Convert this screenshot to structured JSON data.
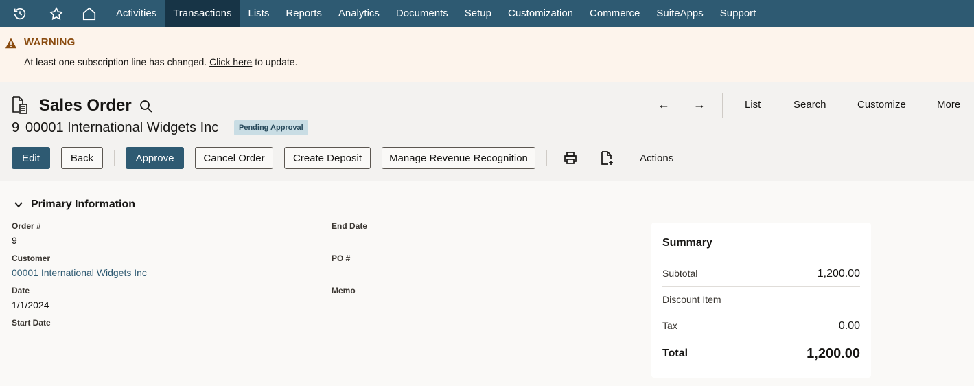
{
  "nav": {
    "icons": [
      "history-icon",
      "star-icon",
      "home-icon"
    ],
    "items": [
      {
        "label": "Activities"
      },
      {
        "label": "Transactions"
      },
      {
        "label": "Lists"
      },
      {
        "label": "Reports"
      },
      {
        "label": "Analytics"
      },
      {
        "label": "Documents"
      },
      {
        "label": "Setup"
      },
      {
        "label": "Customization"
      },
      {
        "label": "Commerce"
      },
      {
        "label": "SuiteApps"
      },
      {
        "label": "Support"
      }
    ],
    "active": "Transactions"
  },
  "warning": {
    "title": "WARNING",
    "message_before": "At least one subscription line has changed.",
    "link_text": "Click here",
    "message_after": "to update."
  },
  "header": {
    "title": "Sales Order",
    "record_number": "9",
    "record_name": "00001 International Widgets Inc",
    "status": "Pending Approval",
    "nav_links": {
      "list": "List",
      "search": "Search",
      "customize": "Customize",
      "more": "More"
    },
    "prev_arrow": "←",
    "next_arrow": "→"
  },
  "buttons": {
    "edit": "Edit",
    "back": "Back",
    "approve": "Approve",
    "cancel_order": "Cancel Order",
    "create_deposit": "Create Deposit",
    "manage_rev_rec": "Manage Revenue Recognition",
    "actions": "Actions"
  },
  "primary": {
    "section_title": "Primary Information",
    "fields": {
      "order_label": "Order #",
      "order_value": "9",
      "customer_label": "Customer",
      "customer_value": "00001 International Widgets Inc",
      "date_label": "Date",
      "date_value": "1/1/2024",
      "start_date_label": "Start Date",
      "end_date_label": "End Date",
      "po_label": "PO #",
      "memo_label": "Memo"
    }
  },
  "summary": {
    "title": "Summary",
    "subtotal_label": "Subtotal",
    "subtotal_value": "1,200.00",
    "discount_label": "Discount Item",
    "tax_label": "Tax",
    "tax_value": "0.00",
    "total_label": "Total",
    "total_value": "1,200.00"
  },
  "colors": {
    "nav_bg": "#2e5a72",
    "nav_active": "#173446",
    "warning_bg": "#fdf4ec",
    "warning_title": "#8a4b0f",
    "badge_bg": "#c9dde4",
    "link": "#2e5a72"
  }
}
